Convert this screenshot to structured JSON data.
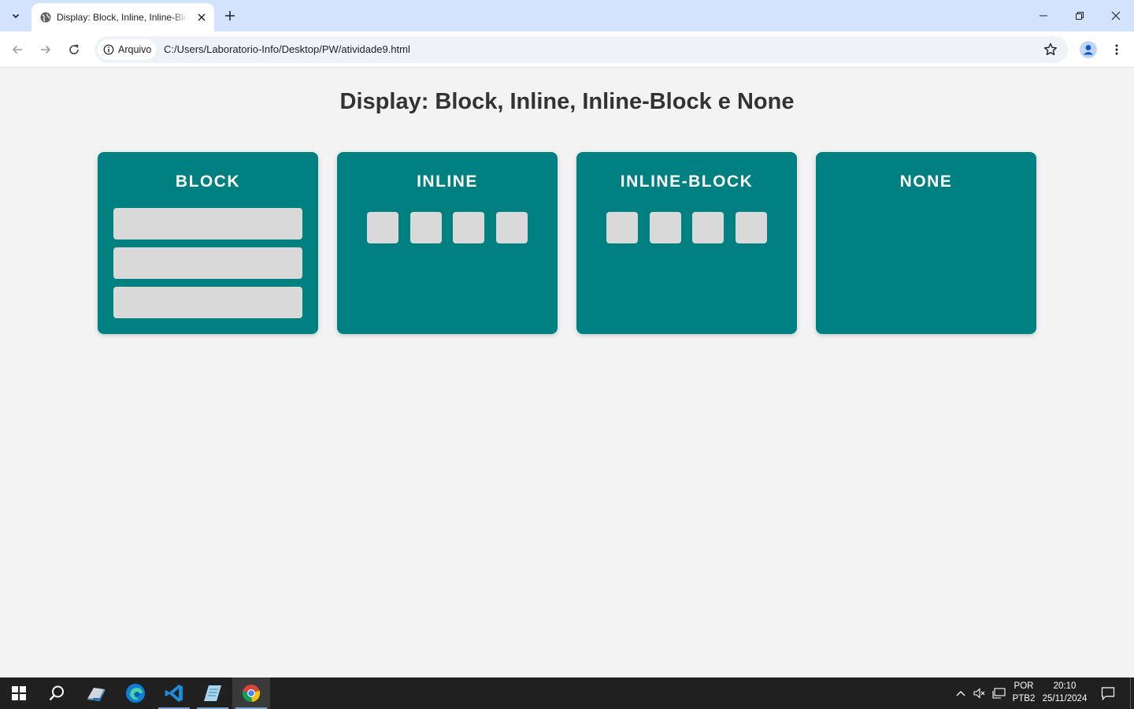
{
  "browser": {
    "tab_title": "Display: Block, Inline, Inline-Block e None",
    "security_chip": "Arquivo",
    "url": "C:/Users/Laboratorio-Info/Desktop/PW/atividade9.html"
  },
  "page": {
    "title": "Display: Block, Inline, Inline-Block e None",
    "accent_color": "#008080",
    "item_color": "#d9d9d9",
    "cards": [
      {
        "label": "BLOCK",
        "items": 3
      },
      {
        "label": "INLINE",
        "items": 4
      },
      {
        "label": "INLINE-BLOCK",
        "items": 4
      },
      {
        "label": "NONE",
        "items": 0
      }
    ]
  },
  "taskbar": {
    "apps": [
      "start-icon",
      "search-icon",
      "file-explorer-icon",
      "edge-icon",
      "vscode-icon",
      "notepad-icon",
      "chrome-icon"
    ],
    "language_line1": "POR",
    "language_line2": "PTB2",
    "time": "20:10",
    "date": "25/11/2024"
  }
}
